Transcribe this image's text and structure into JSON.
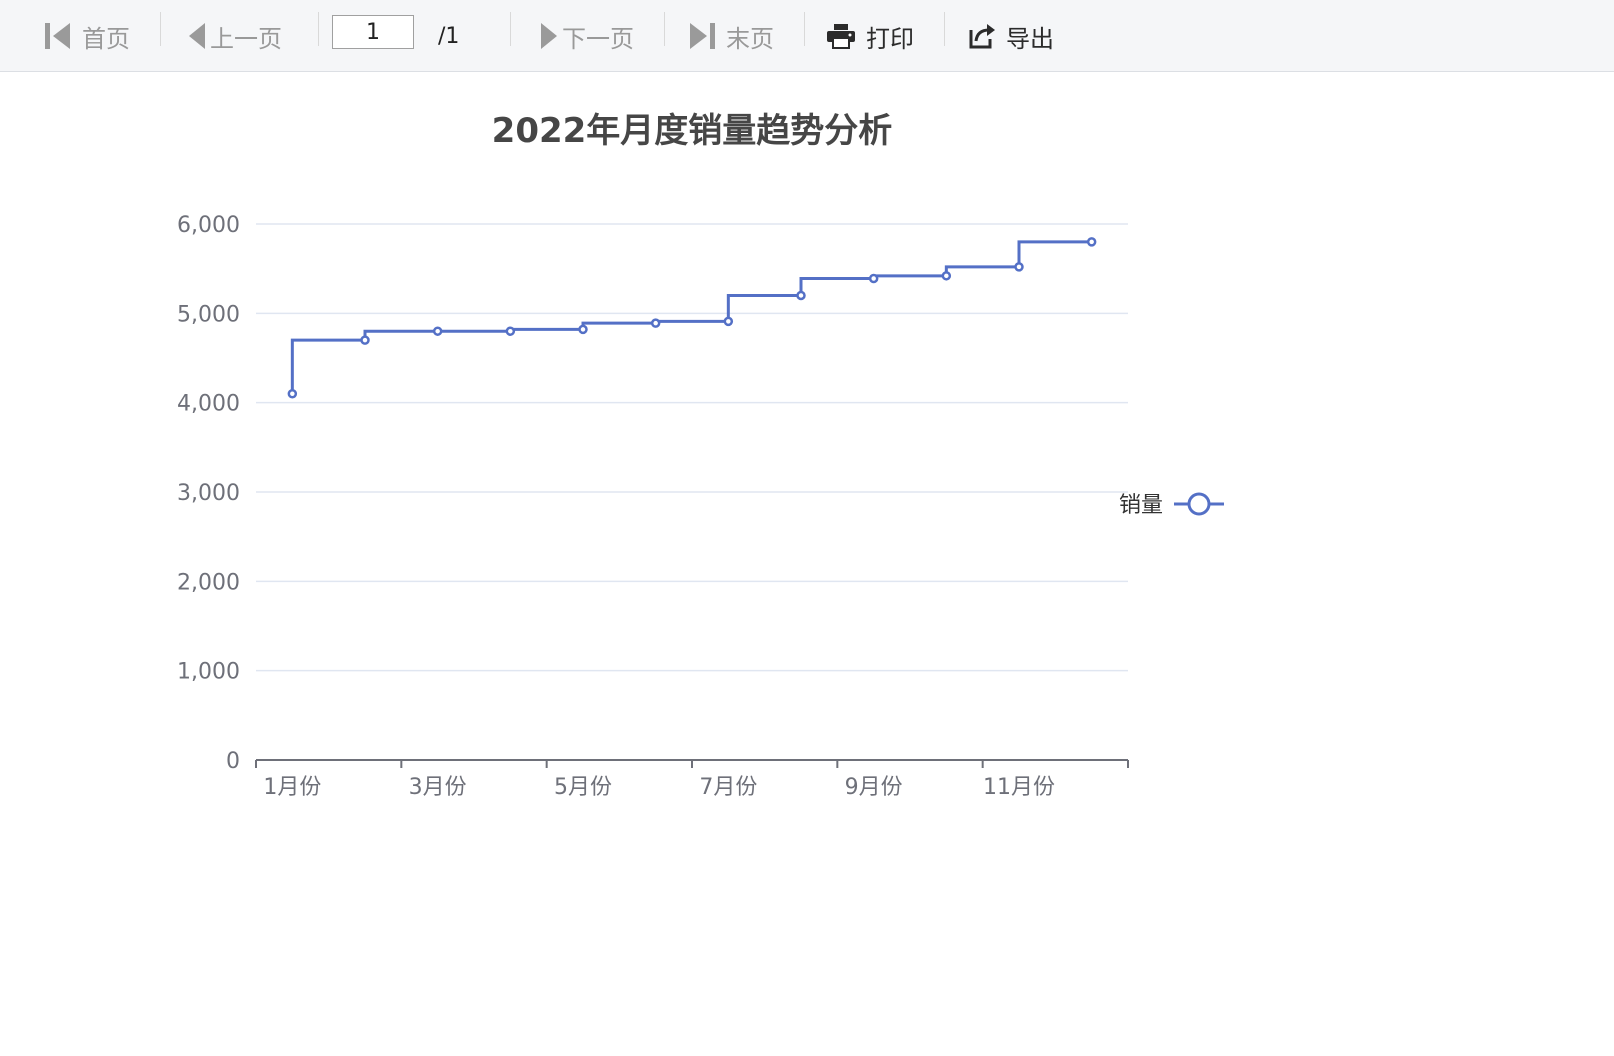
{
  "toolbar": {
    "first": "首页",
    "prev": "上一页",
    "page_value": "1",
    "page_total": "/1",
    "next": "下一页",
    "last": "末页",
    "print": "打印",
    "export": "导出"
  },
  "chart_data": {
    "type": "line",
    "step": true,
    "title": "2022年月度销量趋势分析",
    "categories": [
      "1月份",
      "2月份",
      "3月份",
      "4月份",
      "5月份",
      "6月份",
      "7月份",
      "8月份",
      "9月份",
      "10月份",
      "11月份",
      "12月份"
    ],
    "visible_x_labels": [
      "1月份",
      "3月份",
      "5月份",
      "7月份",
      "9月份",
      "11月份"
    ],
    "series": [
      {
        "name": "销量",
        "values": [
          4100,
          4700,
          4800,
          4800,
          4820,
          4890,
          4910,
          5200,
          5390,
          5420,
          5520,
          5800
        ]
      }
    ],
    "y_ticks": [
      "0",
      "1,000",
      "2,000",
      "3,000",
      "4,000",
      "5,000",
      "6,000"
    ],
    "ylim": [
      0,
      6000
    ],
    "grid": true,
    "legend_position": "right",
    "colors": {
      "series": "#5470c6",
      "grid": "#e0e6f1",
      "axis": "#6e7079",
      "title": "#464646"
    }
  }
}
